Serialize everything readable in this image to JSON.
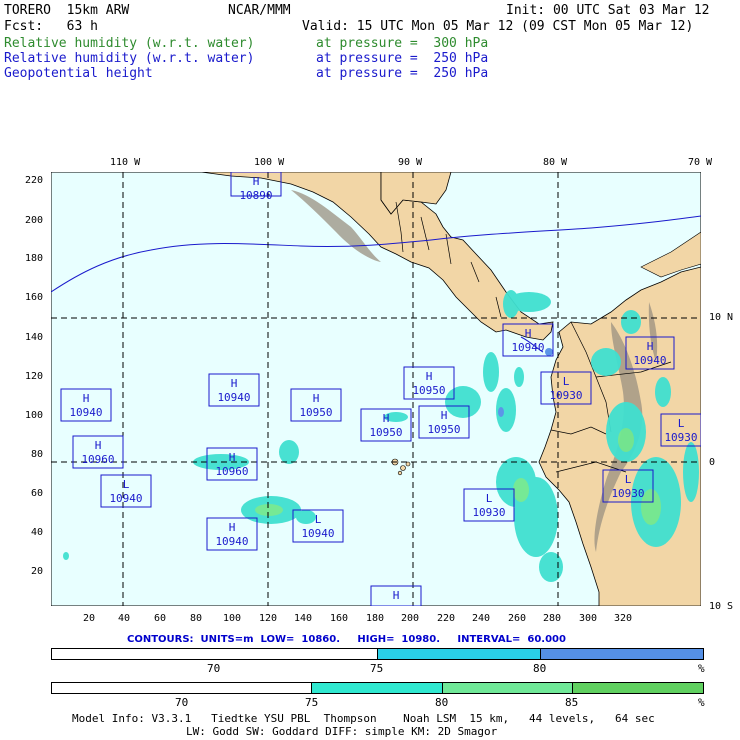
{
  "header": {
    "model": "TORERO  15km ARW",
    "center": "NCAR/MMM",
    "init": "Init: 00 UTC Sat 03 Mar 12",
    "fcst": "Fcst:   63 h",
    "valid": "Valid: 15 UTC Mon 05 Mar 12 (09 CST Mon 05 Mar 12)",
    "fields": [
      {
        "name": "Relative humidity (w.r.t. water)",
        "level": "at pressure =  300 hPa",
        "color": "#2e8b2e"
      },
      {
        "name": "Relative humidity (w.r.t. water)",
        "level": "at pressure =  250 hPa",
        "color": "#1a1acc"
      },
      {
        "name": "Geopotential height",
        "level": "at pressure =  250 hPa",
        "color": "#1a1acc"
      }
    ]
  },
  "map": {
    "top_lon_labels": [
      "110 W",
      "100 W",
      "90 W",
      "80 W",
      "70 W"
    ],
    "right_lat_labels": [
      "10 N",
      "0",
      "10 S"
    ],
    "y_ticks": [
      "220",
      "200",
      "180",
      "160",
      "140",
      "120",
      "100",
      "80",
      "60",
      "40",
      "20"
    ],
    "x_ticks": [
      "20",
      "40",
      "60",
      "80",
      "100",
      "120",
      "140",
      "160",
      "180",
      "200",
      "220",
      "240",
      "260",
      "280",
      "300",
      "320"
    ],
    "colors": {
      "ocean": "#e8ffff",
      "land": "#f2d6a6",
      "mountain": "#9a9080",
      "grid": "#000000",
      "boundary": "#000000",
      "contour": "#1a1acc",
      "rh_light": "#40e0d0",
      "rh_mid": "#70e890"
    },
    "centers": [
      {
        "type": "H",
        "value": "10890"
      },
      {
        "type": "H",
        "value": "10940"
      },
      {
        "type": "H",
        "value": "10940"
      },
      {
        "type": "H",
        "value": "10950"
      },
      {
        "type": "H",
        "value": "10950"
      },
      {
        "type": "H",
        "value": "10950"
      },
      {
        "type": "H",
        "value": "10950"
      },
      {
        "type": "H",
        "value": "10940"
      },
      {
        "type": "H",
        "value": "10940"
      },
      {
        "type": "H",
        "value": "10960"
      },
      {
        "type": "L",
        "value": "10940"
      },
      {
        "type": "H",
        "value": "10960"
      },
      {
        "type": "L",
        "value": "10940"
      },
      {
        "type": "L",
        "value": "10930"
      },
      {
        "type": "L",
        "value": "10930"
      },
      {
        "type": "L",
        "value": "10930"
      },
      {
        "type": "L",
        "value": "10930"
      },
      {
        "type": "H",
        "value": "10940"
      },
      {
        "type": "H",
        "value": ""
      }
    ]
  },
  "contours": {
    "label": "CONTOURS:  UNITS=m  LOW=  10860.     HIGH=  10980.     INTERVAL=  60.000"
  },
  "colorbar1": {
    "segments": [
      {
        "color": "#ffffff",
        "frac": 0.5
      },
      {
        "color": "#2ad0e8",
        "frac": 0.25
      },
      {
        "color": "#5590e6",
        "frac": 0.25
      }
    ],
    "labels": [
      "70",
      "75",
      "80"
    ],
    "unit": "%"
  },
  "colorbar2": {
    "segments": [
      {
        "color": "#ffffff",
        "frac": 0.4
      },
      {
        "color": "#30e8d0",
        "frac": 0.2
      },
      {
        "color": "#70e898",
        "frac": 0.2
      },
      {
        "color": "#60d060",
        "frac": 0.2
      }
    ],
    "labels": [
      "70",
      "75",
      "80",
      "85"
    ],
    "unit": "%"
  },
  "footer": {
    "line1": "Model Info: V3.3.1   Tiedtke YSU PBL  Thompson    Noah LSM  15 km,   44 levels,   64 sec",
    "line2": "LW: Godd SW: Goddard DIFF: simple KM: 2D Smagor"
  }
}
